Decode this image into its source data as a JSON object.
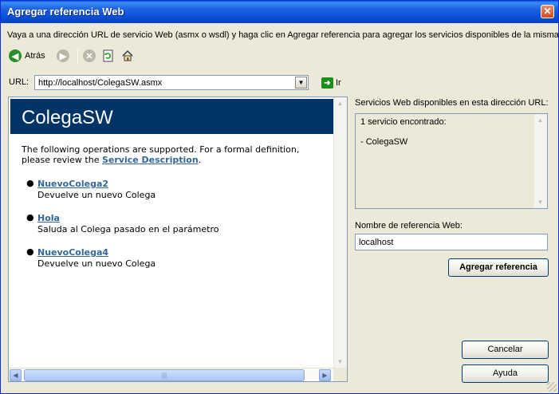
{
  "window": {
    "title": "Agregar referencia Web",
    "close_glyph": "✕"
  },
  "instruction": "Vaya a una dirección URL de servicio Web (asmx o wsdl) y haga clic en Agregar referencia para agregar los servicios disponibles de la misma.",
  "toolbar": {
    "back_label": "Atrás",
    "back_icon": "back-arrow-icon",
    "forward_icon": "forward-arrow-icon",
    "stop_icon": "stop-icon",
    "refresh_icon": "refresh-icon",
    "home_icon": "home-icon"
  },
  "address": {
    "label": "URL:",
    "value": "http://localhost/ColegaSW.asmx",
    "go_label": "Ir"
  },
  "browser_page": {
    "heading": "ColegaSW",
    "intro_prefix": "The following operations are supported. For a formal definition, please review the ",
    "intro_link": "Service Description",
    "intro_suffix": ".",
    "operations": [
      {
        "name": "NuevoColega2",
        "description": "Devuelve un nuevo Colega"
      },
      {
        "name": "Hola",
        "description": "Saluda al Colega pasado en el parámetro"
      },
      {
        "name": "NuevoColega4",
        "description": "Devuelve un nuevo Colega"
      }
    ]
  },
  "services": {
    "label": "Servicios Web disponibles en esta dirección URL:",
    "lines": [
      "1 servicio encontrado:",
      "- ColegaSW"
    ]
  },
  "reference": {
    "label": "Nombre de referencia Web:",
    "value": "localhost"
  },
  "buttons": {
    "add": "Agregar referencia",
    "cancel": "Cancelar",
    "help": "Ayuda"
  },
  "colors": {
    "titlebar": "#0a4fd8",
    "page_heading_bg": "#003366",
    "link": "#336699",
    "dialog_bg": "#ece9d8"
  }
}
